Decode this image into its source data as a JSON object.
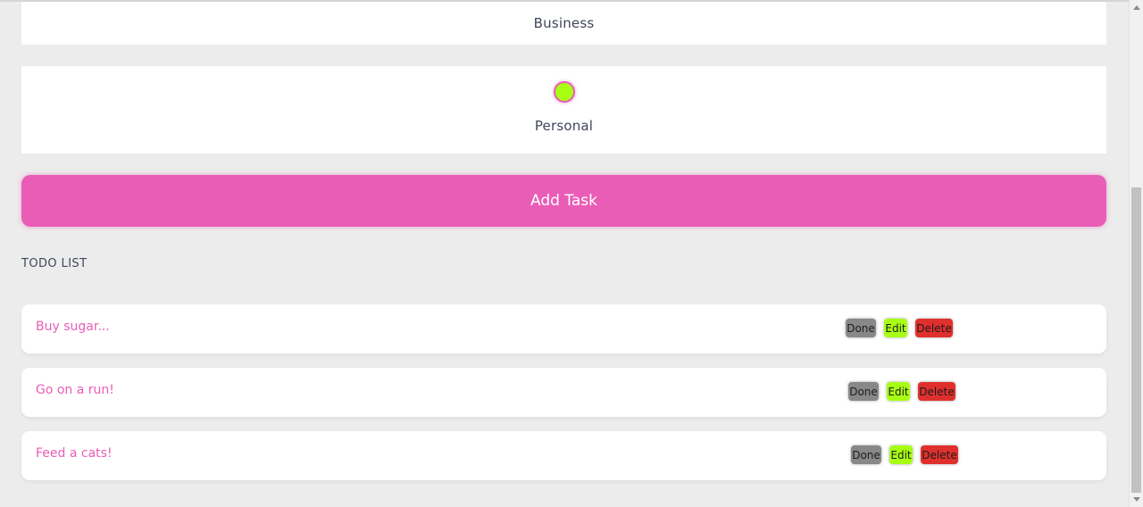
{
  "categories": {
    "business_label": "Business",
    "personal_label": "Personal",
    "personal_selected_color": "#a8ff14"
  },
  "add_task": {
    "label": "Add Task"
  },
  "todo": {
    "title": "TODO LIST",
    "items": [
      {
        "text": "Buy sugar...",
        "done": "Done",
        "edit": "Edit",
        "delete": "Delete"
      },
      {
        "text": "Go on a run!",
        "done": "Done",
        "edit": "Edit",
        "delete": "Delete"
      },
      {
        "text": "Feed a cats!",
        "done": "Done",
        "edit": "Edit",
        "delete": "Delete"
      }
    ]
  },
  "colors": {
    "accent": "#ea5db7",
    "edit": "#a8ff14",
    "delete": "#e0302d",
    "done": "#888888",
    "background": "#ececec"
  },
  "icons": [
    "radio-selected-icon",
    "scroll-up-arrow-icon",
    "scroll-down-arrow-icon"
  ]
}
